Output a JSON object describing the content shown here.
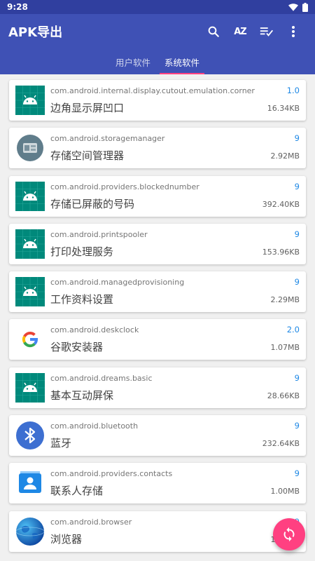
{
  "status_bar": {
    "time": "9:28"
  },
  "app_bar": {
    "title": "APK导出",
    "sort_label": "AZ"
  },
  "tabs": [
    {
      "label": "用户软件",
      "active": false
    },
    {
      "label": "系统软件",
      "active": true
    }
  ],
  "apps": [
    {
      "package": "com.android.internal.display.cutout.emulation.corner",
      "name": "边角显示屏凹口",
      "version": "1.0",
      "size": "16.34KB",
      "icon": "android-icon"
    },
    {
      "package": "com.android.storagemanager",
      "name": "存储空间管理器",
      "version": "9",
      "size": "2.92MB",
      "icon": "storage-manager-icon"
    },
    {
      "package": "com.android.providers.blockednumber",
      "name": "存储已屏蔽的号码",
      "version": "9",
      "size": "392.40KB",
      "icon": "android-icon"
    },
    {
      "package": "com.android.printspooler",
      "name": "打印处理服务",
      "version": "9",
      "size": "153.96KB",
      "icon": "android-icon"
    },
    {
      "package": "com.android.managedprovisioning",
      "name": "工作资料设置",
      "version": "9",
      "size": "2.29MB",
      "icon": "android-icon"
    },
    {
      "package": "com.android.deskclock",
      "name": "谷歌安装器",
      "version": "2.0",
      "size": "1.07MB",
      "icon": "google-icon"
    },
    {
      "package": "com.android.dreams.basic",
      "name": "基本互动屏保",
      "version": "9",
      "size": "28.66KB",
      "icon": "android-icon"
    },
    {
      "package": "com.android.bluetooth",
      "name": "蓝牙",
      "version": "9",
      "size": "232.64KB",
      "icon": "bluetooth-icon"
    },
    {
      "package": "com.android.providers.contacts",
      "name": "联系人存储",
      "version": "9",
      "size": "1.00MB",
      "icon": "contacts-icon"
    },
    {
      "package": "com.android.browser",
      "name": "浏览器",
      "version": "9",
      "size": "1.93MB",
      "icon": "browser-globe-icon"
    }
  ],
  "colors": {
    "primary": "#3f51b5",
    "primary_dark": "#303f9f",
    "accent": "#ff4081",
    "version_blue": "#1e88e5",
    "android_teal": "#00897b"
  }
}
